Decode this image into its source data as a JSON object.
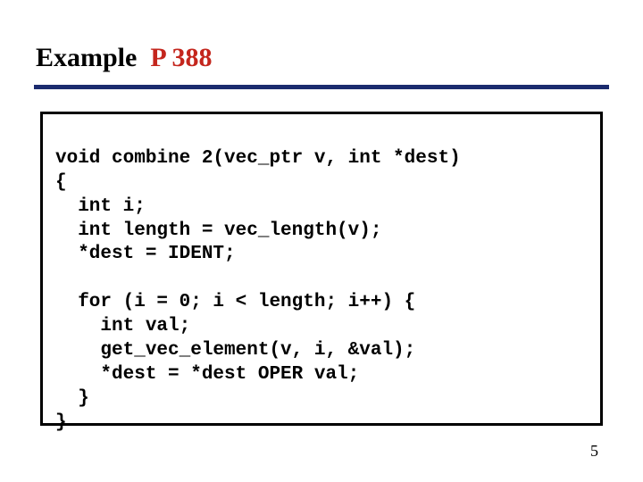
{
  "title": {
    "prefix": "Example  ",
    "accent": "P 388"
  },
  "code": {
    "lines": [
      "void combine 2(vec_ptr v, int *dest)",
      "{",
      "  int i;",
      "  int length = vec_length(v);",
      "  *dest = IDENT;",
      "",
      "  for (i = 0; i < length; i++) {",
      "    int val;",
      "    get_vec_element(v, i, &val);",
      "    *dest = *dest OPER val;",
      "  }",
      "}"
    ]
  },
  "page_number": "5"
}
